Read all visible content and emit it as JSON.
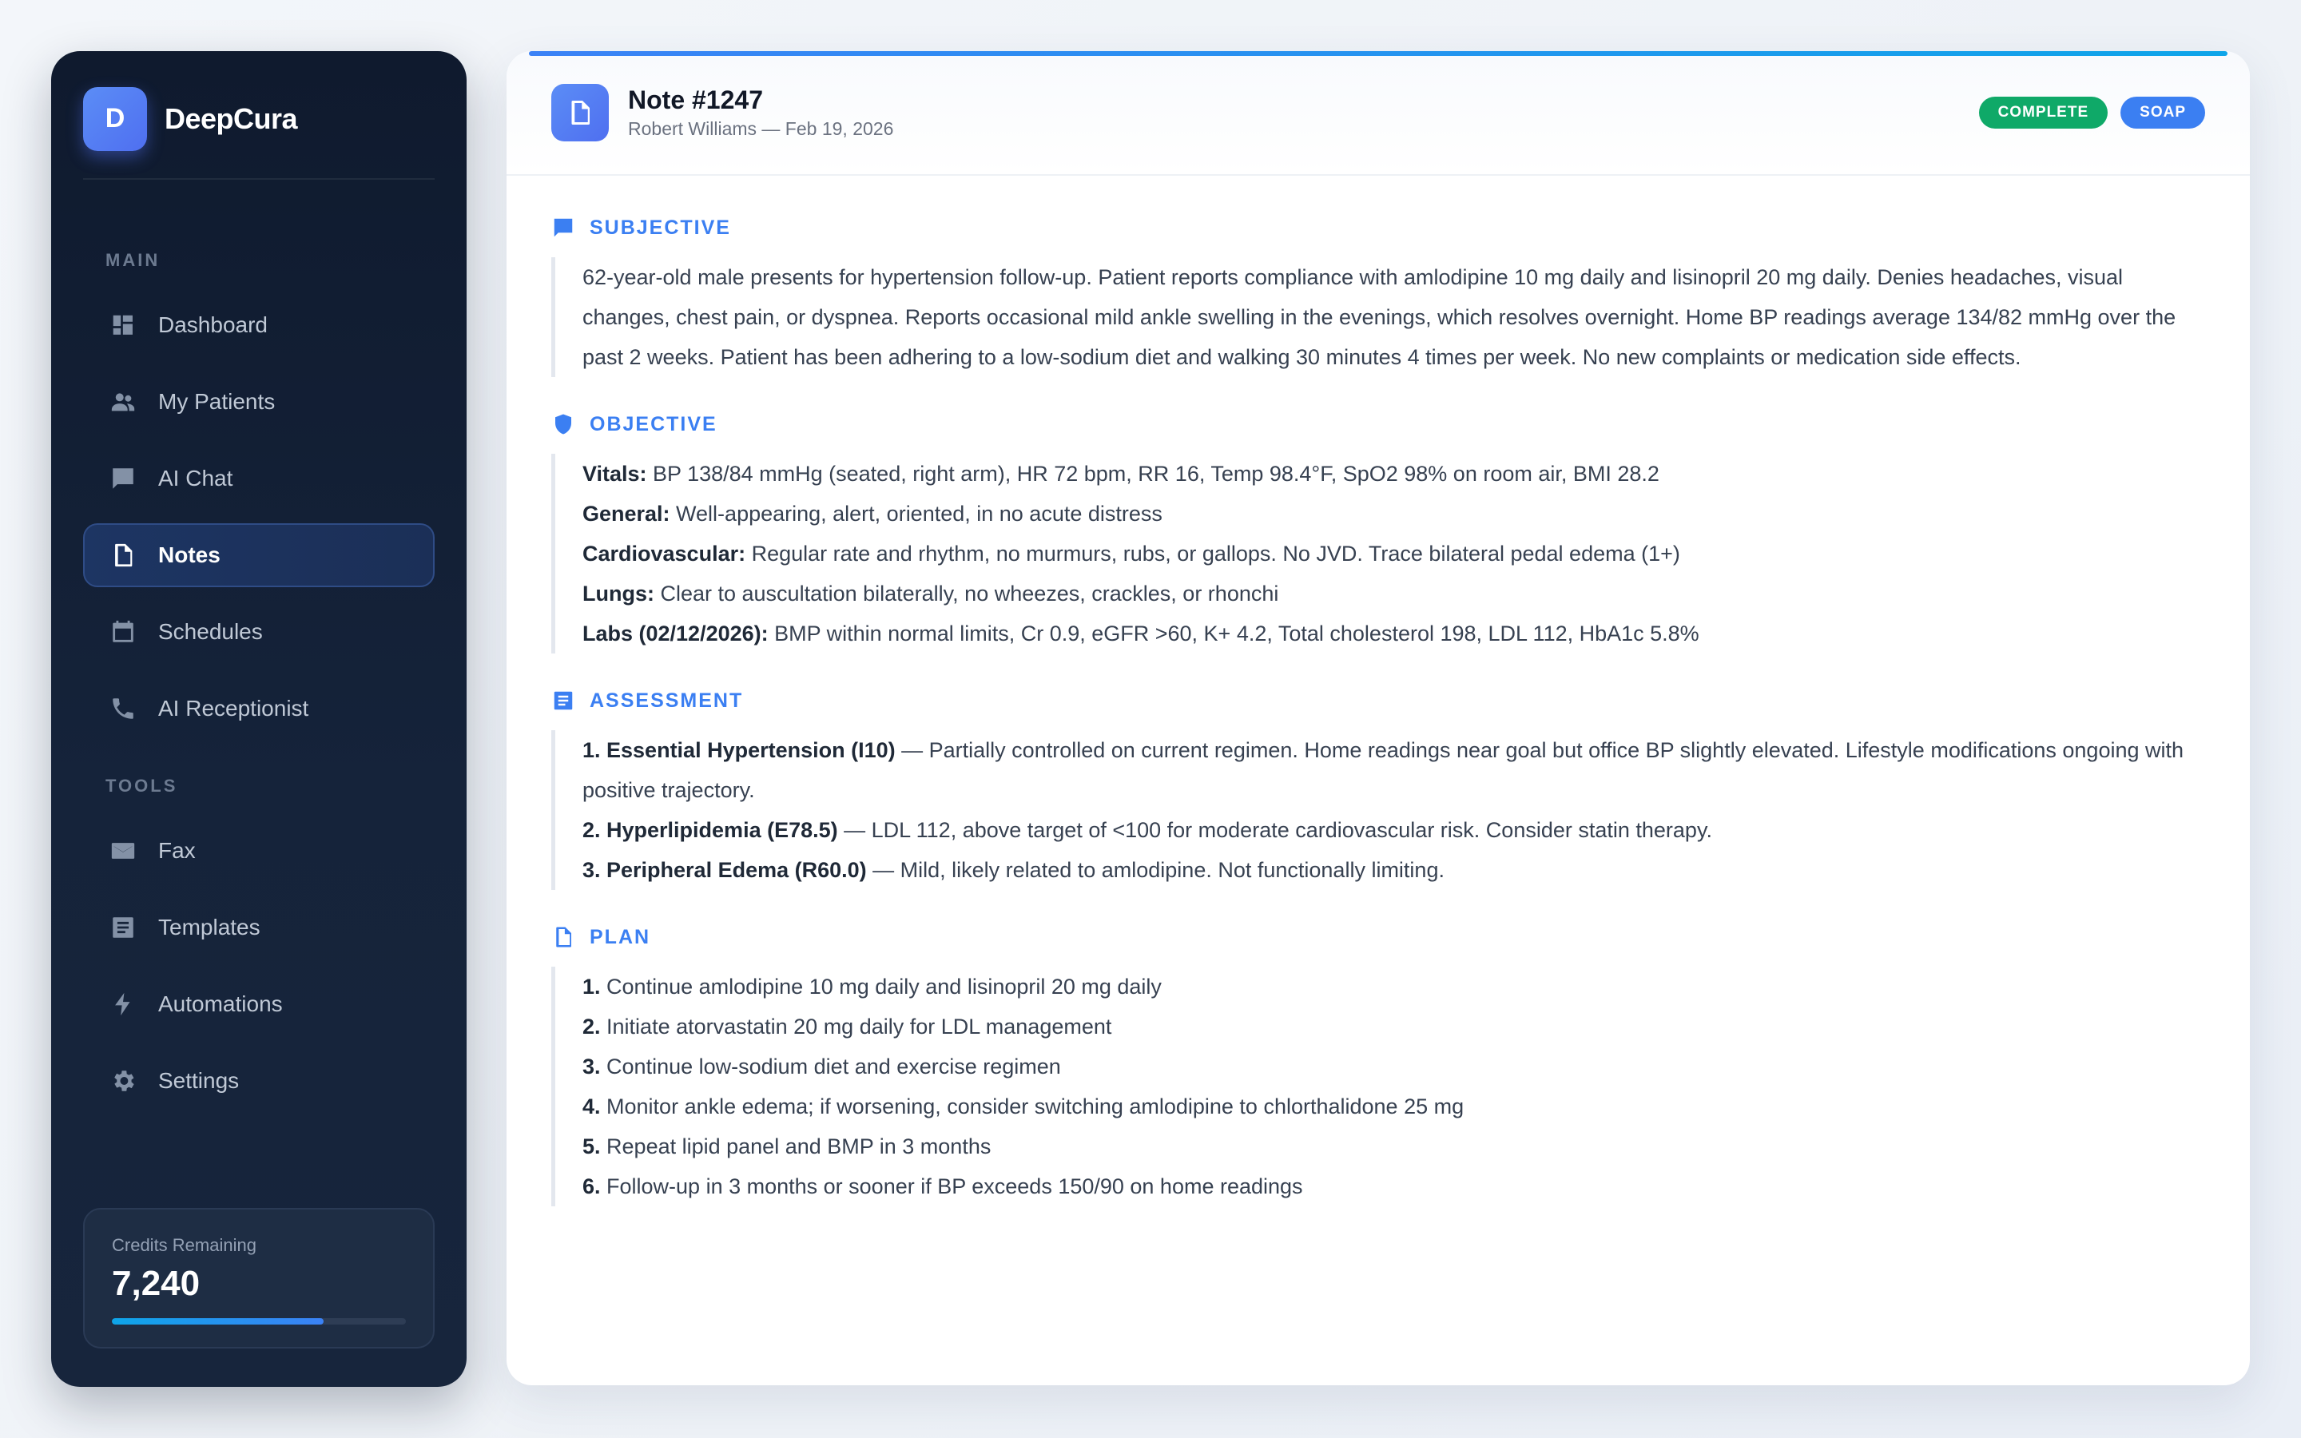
{
  "brand": {
    "logo_letter": "D",
    "name": "DeepCura"
  },
  "nav": {
    "main_label": "MAIN",
    "main_items": [
      {
        "label": "Dashboard",
        "icon": "dashboard-icon"
      },
      {
        "label": "My Patients",
        "icon": "people-icon"
      },
      {
        "label": "AI Chat",
        "icon": "chat-icon"
      },
      {
        "label": "Notes",
        "icon": "document-icon",
        "active": true
      },
      {
        "label": "Schedules",
        "icon": "calendar-icon"
      },
      {
        "label": "AI Receptionist",
        "icon": "phone-icon"
      }
    ],
    "tools_label": "TOOLS",
    "tools_items": [
      {
        "label": "Fax",
        "icon": "mail-icon"
      },
      {
        "label": "Templates",
        "icon": "template-icon"
      },
      {
        "label": "Automations",
        "icon": "bolt-icon"
      },
      {
        "label": "Settings",
        "icon": "gear-icon"
      }
    ]
  },
  "credits": {
    "label": "Credits Remaining",
    "value": "7,240",
    "fill_fraction": 0.72
  },
  "note": {
    "title": "Note #1247",
    "subtitle": "Robert Williams — Feb 19, 2026",
    "badges": {
      "status": "COMPLETE",
      "type": "SOAP"
    }
  },
  "sections": {
    "subjective": {
      "title": "SUBJECTIVE",
      "text": "62-year-old male presents for hypertension follow-up. Patient reports compliance with amlodipine 10 mg daily and lisinopril 20 mg daily. Denies headaches, visual changes, chest pain, or dyspnea. Reports occasional mild ankle swelling in the evenings, which resolves overnight. Home BP readings average 134/82 mmHg over the past 2 weeks. Patient has been adhering to a low-sodium diet and walking 30 minutes 4 times per week. No new complaints or medication side effects."
    },
    "objective": {
      "title": "OBJECTIVE",
      "lines": [
        {
          "label": "Vitals:",
          "text": " BP 138/84 mmHg (seated, right arm), HR 72 bpm, RR 16, Temp 98.4°F, SpO2 98% on room air, BMI 28.2"
        },
        {
          "label": "General:",
          "text": " Well-appearing, alert, oriented, in no acute distress"
        },
        {
          "label": "Cardiovascular:",
          "text": " Regular rate and rhythm, no murmurs, rubs, or gallops. No JVD. Trace bilateral pedal edema (1+)"
        },
        {
          "label": "Lungs:",
          "text": " Clear to auscultation bilaterally, no wheezes, crackles, or rhonchi"
        },
        {
          "label": "Labs (02/12/2026):",
          "text": " BMP within normal limits, Cr 0.9, eGFR >60, K+ 4.2, Total cholesterol 198, LDL 112, HbA1c 5.8%"
        }
      ]
    },
    "assessment": {
      "title": "ASSESSMENT",
      "lines": [
        {
          "label": "1. Essential Hypertension (I10)",
          "text": " — Partially controlled on current regimen. Home readings near goal but office BP slightly elevated. Lifestyle modifications ongoing with positive trajectory."
        },
        {
          "label": "2. Hyperlipidemia (E78.5)",
          "text": " — LDL 112, above target of <100 for moderate cardiovascular risk. Consider statin therapy."
        },
        {
          "label": "3. Peripheral Edema (R60.0)",
          "text": " — Mild, likely related to amlodipine. Not functionally limiting."
        }
      ]
    },
    "plan": {
      "title": "PLAN",
      "lines": [
        {
          "label": "1.",
          "text": " Continue amlodipine 10 mg daily and lisinopril 20 mg daily"
        },
        {
          "label": "2.",
          "text": " Initiate atorvastatin 20 mg daily for LDL management"
        },
        {
          "label": "3.",
          "text": " Continue low-sodium diet and exercise regimen"
        },
        {
          "label": "4.",
          "text": " Monitor ankle edema; if worsening, consider switching amlodipine to chlorthalidone 25 mg"
        },
        {
          "label": "5.",
          "text": " Repeat lipid panel and BMP in 3 months"
        },
        {
          "label": "6.",
          "text": " Follow-up in 3 months or sooner if BP exceeds 150/90 on home readings"
        }
      ]
    }
  },
  "colors": {
    "accent": "#3b7ff2",
    "complete_badge": "#0fa968",
    "sidebar_bg": "#0f1a2e",
    "active_nav": "#1d3563"
  }
}
